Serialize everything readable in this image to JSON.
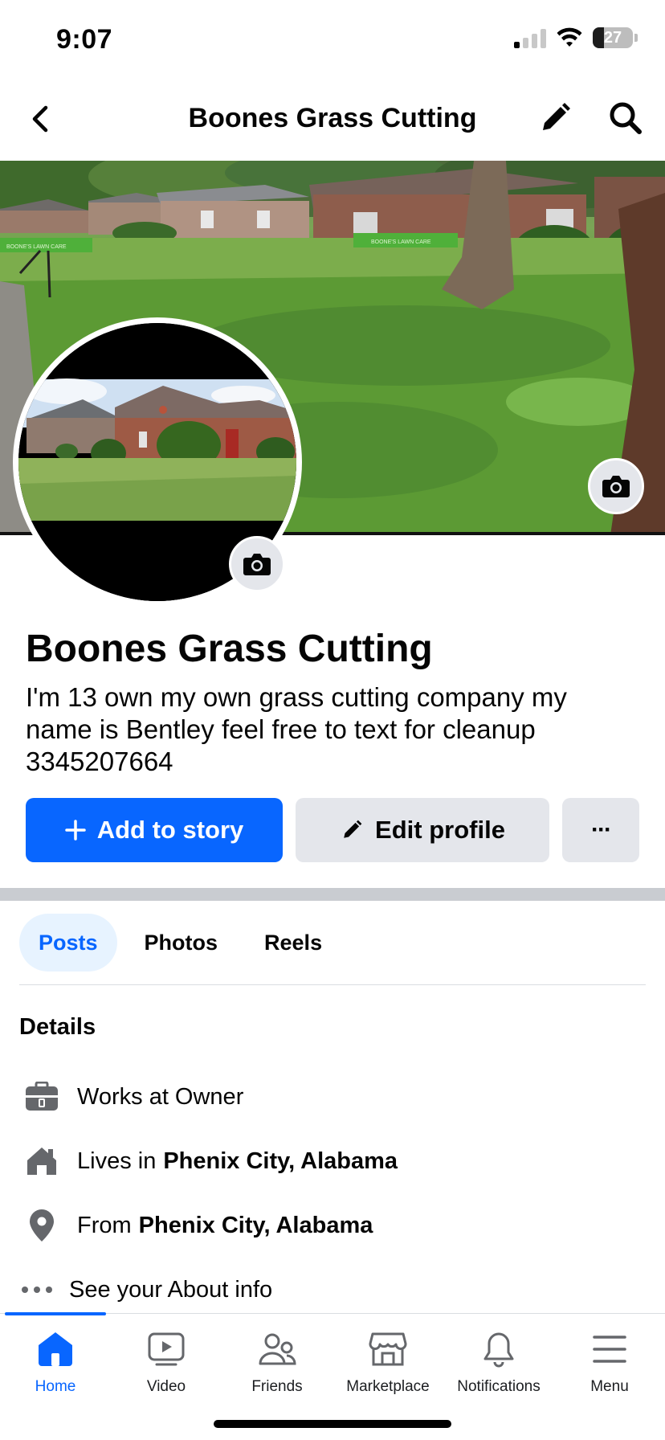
{
  "status_bar": {
    "time": "9:07",
    "battery_level": "27",
    "battery_fraction": 0.27,
    "signal_bars_on": 1,
    "signal_bars_total": 4,
    "icons": [
      "cellular-signal-icon",
      "wifi-icon",
      "battery-icon"
    ]
  },
  "nav": {
    "title": "Boones Grass Cutting",
    "back_icon": "chevron-left-icon",
    "edit_icon": "pencil-icon",
    "search_icon": "search-icon"
  },
  "cover": {
    "camera_icon": "camera-icon",
    "sign_left": "BOONE'S LAWN CARE",
    "sign_right": "BOONE'S LAWN CARE"
  },
  "profile": {
    "name": "Boones Grass Cutting",
    "bio": "I'm 13 own my own grass cutting company my name is Bentley feel free to text for cleanup 3345207664"
  },
  "actions": {
    "add_story": "Add to story",
    "edit_profile": "Edit profile",
    "more": "···"
  },
  "tabs": [
    {
      "label": "Posts",
      "active": true
    },
    {
      "label": "Photos",
      "active": false
    },
    {
      "label": "Reels",
      "active": false
    }
  ],
  "details": {
    "heading": "Details",
    "work": {
      "prefix": "Works at Owner",
      "bold": ""
    },
    "lives": {
      "prefix": "Lives in",
      "bold": "Phenix City, Alabama"
    },
    "from": {
      "prefix": "From",
      "bold": "Phenix City, Alabama"
    },
    "about": "See your About info"
  },
  "bottom_nav": [
    {
      "label": "Home",
      "icon": "home-icon",
      "active": true
    },
    {
      "label": "Video",
      "icon": "video-icon",
      "active": false
    },
    {
      "label": "Friends",
      "icon": "friends-icon",
      "active": false
    },
    {
      "label": "Marketplace",
      "icon": "marketplace-icon",
      "active": false
    },
    {
      "label": "Notifications",
      "icon": "bell-icon",
      "active": false
    },
    {
      "label": "Menu",
      "icon": "menu-icon",
      "active": false
    }
  ],
  "colors": {
    "accent": "#0866ff",
    "button_gray": "#e4e6eb",
    "tab_active_bg": "#e7f3ff",
    "divider": "#c9ccd1"
  }
}
